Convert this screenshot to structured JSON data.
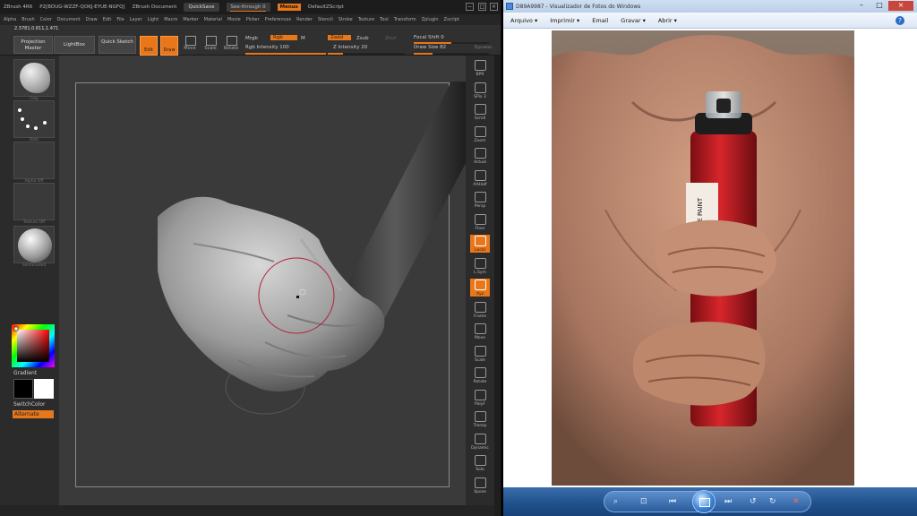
{
  "zbrush": {
    "title_items": [
      "ZBrush 4R6",
      "P2[BDUG-WZZF-QOKJ-EYUE-NGFQ]",
      "ZBrush Document"
    ],
    "quicksave": "QuickSave",
    "see_through": "See-through",
    "see_through_value": "0",
    "menus": "Menus",
    "script": "DefaultZScript",
    "menubar": [
      "Alpha",
      "Brush",
      "Color",
      "Document",
      "Draw",
      "Edit",
      "File",
      "Layer",
      "Light",
      "Macro",
      "Marker",
      "Material",
      "Movie",
      "Picker",
      "Preferences",
      "Render",
      "Stencil",
      "Stroke",
      "Texture",
      "Tool",
      "Transform",
      "Zplugin",
      "Zscript"
    ],
    "coords": "2.3781,0.811,1.471",
    "projection_master": "Projection Master",
    "lightbox": "LightBox",
    "quick_sketch": "Quick Sketch",
    "tools": {
      "edit": "Edit",
      "draw": "Draw",
      "move": "Move",
      "scale": "Scale",
      "rotate": "Rotate"
    },
    "mrgb": "Mrgb",
    "rgb": "Rgb",
    "m": "M",
    "rgb_intensity_label": "Rgb Intensity",
    "rgb_intensity_value": "100",
    "rgb_intensity_fill": 1.0,
    "zadd": "Zadd",
    "zsub": "Zsub",
    "zcut": "Zcut",
    "z_intensity_label": "Z Intensity",
    "z_intensity_value": "20",
    "z_intensity_fill": 0.2,
    "focal_shift_label": "Focal Shift",
    "focal_shift_value": "0",
    "focal_shift_fill": 0.5,
    "draw_size_label": "Draw Size",
    "draw_size_value": "82",
    "draw_size_fill": 0.25,
    "dynamic": "Dynamic",
    "left_tray": {
      "brush_label": "Clay",
      "stroke_label": "Dots",
      "alpha_label": "Alpha Off",
      "texture_label": "Texture Off",
      "material_label": "SkinShade4",
      "gradient": "Gradient",
      "switch_color": "SwitchColor",
      "alternate": "Alternate"
    },
    "right_shelf": [
      {
        "label": "BPR"
      },
      {
        "label": "SPix",
        "value": "3"
      },
      {
        "label": "Scroll"
      },
      {
        "label": "Zoom"
      },
      {
        "label": "Actual"
      },
      {
        "label": "AAHalf"
      },
      {
        "label": "Persp"
      },
      {
        "label": "Floor"
      },
      {
        "label": "Local",
        "active": true
      },
      {
        "label": "L.Sym"
      },
      {
        "label": "Xyz",
        "active": true
      },
      {
        "label": "Frame"
      },
      {
        "label": "Move"
      },
      {
        "label": "Scale"
      },
      {
        "label": "Rotate"
      },
      {
        "label": "PolyF"
      },
      {
        "label": "Transp"
      },
      {
        "label": "Dynamic"
      },
      {
        "label": "Solo"
      },
      {
        "label": "Xpose"
      }
    ]
  },
  "viewer": {
    "title": "D89A9987 - Visualizador de Fotos do Windows",
    "menu": [
      {
        "label": "Arquivo",
        "dropdown": true
      },
      {
        "label": "Imprimir",
        "dropdown": true
      },
      {
        "label": "Email",
        "dropdown": false
      },
      {
        "label": "Gravar",
        "dropdown": true
      },
      {
        "label": "Abrir",
        "dropdown": true
      }
    ],
    "help": "?",
    "can_text": "THE PAINT",
    "colors": {
      "accent": "#e8761a",
      "viewer_bar": "#1f4f8a",
      "can_red": "#c41e24"
    }
  }
}
